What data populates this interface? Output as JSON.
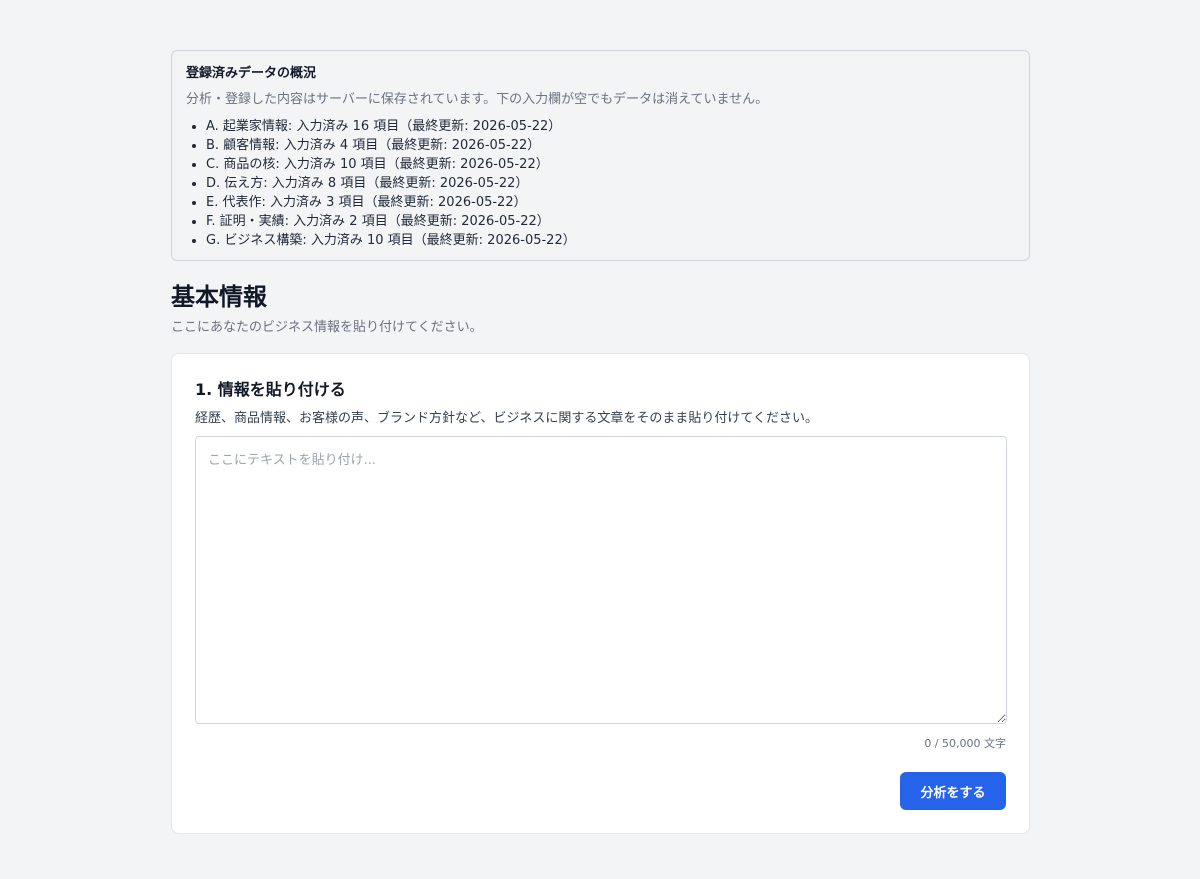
{
  "summary": {
    "title": "登録済みデータの概況",
    "description": "分析・登録した内容はサーバーに保存されています。下の入力欄が空でもデータは消えていません。",
    "items": [
      "A. 起業家情報: 入力済み 16 項目（最終更新: 2026-05-22）",
      "B. 顧客情報: 入力済み 4 項目（最終更新: 2026-05-22）",
      "C. 商品の核: 入力済み 10 項目（最終更新: 2026-05-22）",
      "D. 伝え方: 入力済み 8 項目（最終更新: 2026-05-22）",
      "E. 代表作: 入力済み 3 項目（最終更新: 2026-05-22）",
      "F. 証明・実績: 入力済み 2 項目（最終更新: 2026-05-22）",
      "G. ビジネス構築: 入力済み 10 項目（最終更新: 2026-05-22）"
    ]
  },
  "section": {
    "title": "基本情報",
    "subtitle": "ここにあなたのビジネス情報を貼り付けてください。"
  },
  "paste_card": {
    "title": "1. 情報を貼り付ける",
    "description": "経歴、商品情報、お客様の声、ブランド方針など、ビジネスに関する文章をそのまま貼り付けてください。",
    "textarea_value": "",
    "textarea_placeholder": "ここにテキストを貼り付け...",
    "counter": "0 / 50,000 文字",
    "submit_label": "分析をする"
  },
  "colors": {
    "accent": "#2563eb",
    "background": "#f3f4f6"
  }
}
